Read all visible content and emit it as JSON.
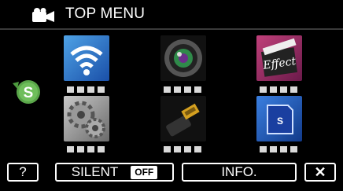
{
  "header": {
    "title": "TOP MENU",
    "icon": "video-camera-icon"
  },
  "back_button": {
    "label": "S",
    "icon": "back-arrow-icon"
  },
  "tiles": [
    {
      "name": "wireless",
      "icon": "wifi-icon"
    },
    {
      "name": "camera-lens",
      "icon": "lens-icon"
    },
    {
      "name": "effect",
      "icon": "effect-clapboard-icon",
      "label": "Effect"
    },
    {
      "name": "settings",
      "icon": "gears-icon"
    },
    {
      "name": "connection",
      "icon": "hdmi-plug-icon"
    },
    {
      "name": "media",
      "icon": "sd-card-icon",
      "label": "S"
    }
  ],
  "bottom": {
    "help": "?",
    "silent": "SILENT",
    "silent_state": "OFF",
    "info": "INFO.",
    "close": "✕"
  },
  "colors": {
    "accent_green": "#5aa64a",
    "tile_blue": "#1f5fb8",
    "tile_purple": "#8a1f5a"
  }
}
